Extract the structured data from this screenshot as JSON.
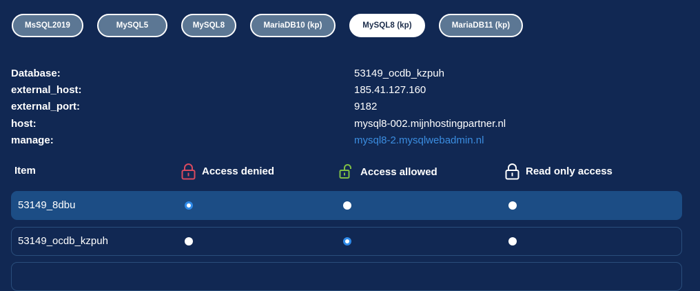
{
  "tabs": [
    {
      "label": "MsSQL2019",
      "active": false
    },
    {
      "label": "MySQL5",
      "active": false
    },
    {
      "label": "MySQL8",
      "active": false
    },
    {
      "label": "MariaDB10 (kp)",
      "active": false
    },
    {
      "label": "MySQL8 (kp)",
      "active": true
    },
    {
      "label": "MariaDB11 (kp)",
      "active": false
    }
  ],
  "info": {
    "database_label": "Database:",
    "database_value": "53149_ocdb_kzpuh",
    "external_host_label": "external_host:",
    "external_host_value": "185.41.127.160",
    "external_port_label": "external_port:",
    "external_port_value": "9182",
    "host_label": "host:",
    "host_value": "mysql8-002.mijnhostingpartner.nl",
    "manage_label": "manage:",
    "manage_value": "mysql8-2.mysqlwebadmin.nl"
  },
  "table": {
    "headers": {
      "item": "Item",
      "denied": "Access denied",
      "allowed": "Access allowed",
      "readonly": "Read only access"
    },
    "icons": {
      "denied": "lock-closed-icon",
      "allowed": "lock-open-icon",
      "readonly": "lock-closed-icon"
    },
    "rows": [
      {
        "name": "53149_8dbu",
        "selected": "denied"
      },
      {
        "name": "53149_ocdb_kzpuh",
        "selected": "allowed"
      }
    ]
  },
  "colors": {
    "background": "#112853",
    "selected_row": "#1c4d85",
    "tab_inactive": "#5c7794",
    "link": "#3b8de0",
    "denied_icon": "#d94a5f",
    "allowed_icon": "#7fbf45",
    "radio_checked": "#2f8ae8"
  }
}
